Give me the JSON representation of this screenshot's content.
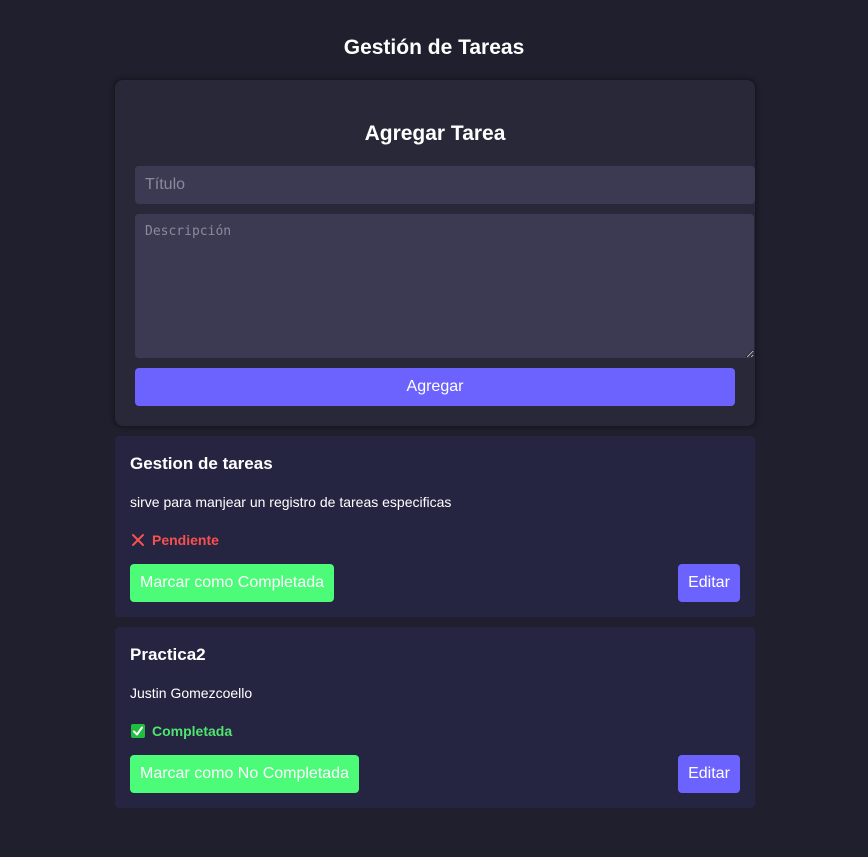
{
  "page": {
    "title": "Gestión de Tareas"
  },
  "form": {
    "heading": "Agregar Tarea",
    "title_placeholder": "Título",
    "title_value": "",
    "description_placeholder": "Descripción",
    "description_value": "",
    "add_label": "Agregar"
  },
  "tasks": [
    {
      "title": "Gestion de tareas",
      "description": "sirve para manjear un registro de tareas especificas",
      "status": "Pendiente",
      "status_icon": "cross-mark-icon",
      "status_color": "#f75050",
      "toggle_label": "Marcar como Completada",
      "edit_label": "Editar"
    },
    {
      "title": "Practica2",
      "description": "Justin Gomezcoello",
      "status": "Completada",
      "status_icon": "check-mark-icon",
      "status_color": "#4ee46e",
      "toggle_label": "Marcar como No Completada",
      "edit_label": "Editar"
    }
  ],
  "colors": {
    "background": "#1f1f2d",
    "form_card": "#282839",
    "task_card": "#252541",
    "input": "#3b3a52",
    "primary": "#6c63ff",
    "success_button": "#4cfc78",
    "pending": "#f75050",
    "completed": "#4ee46e"
  }
}
